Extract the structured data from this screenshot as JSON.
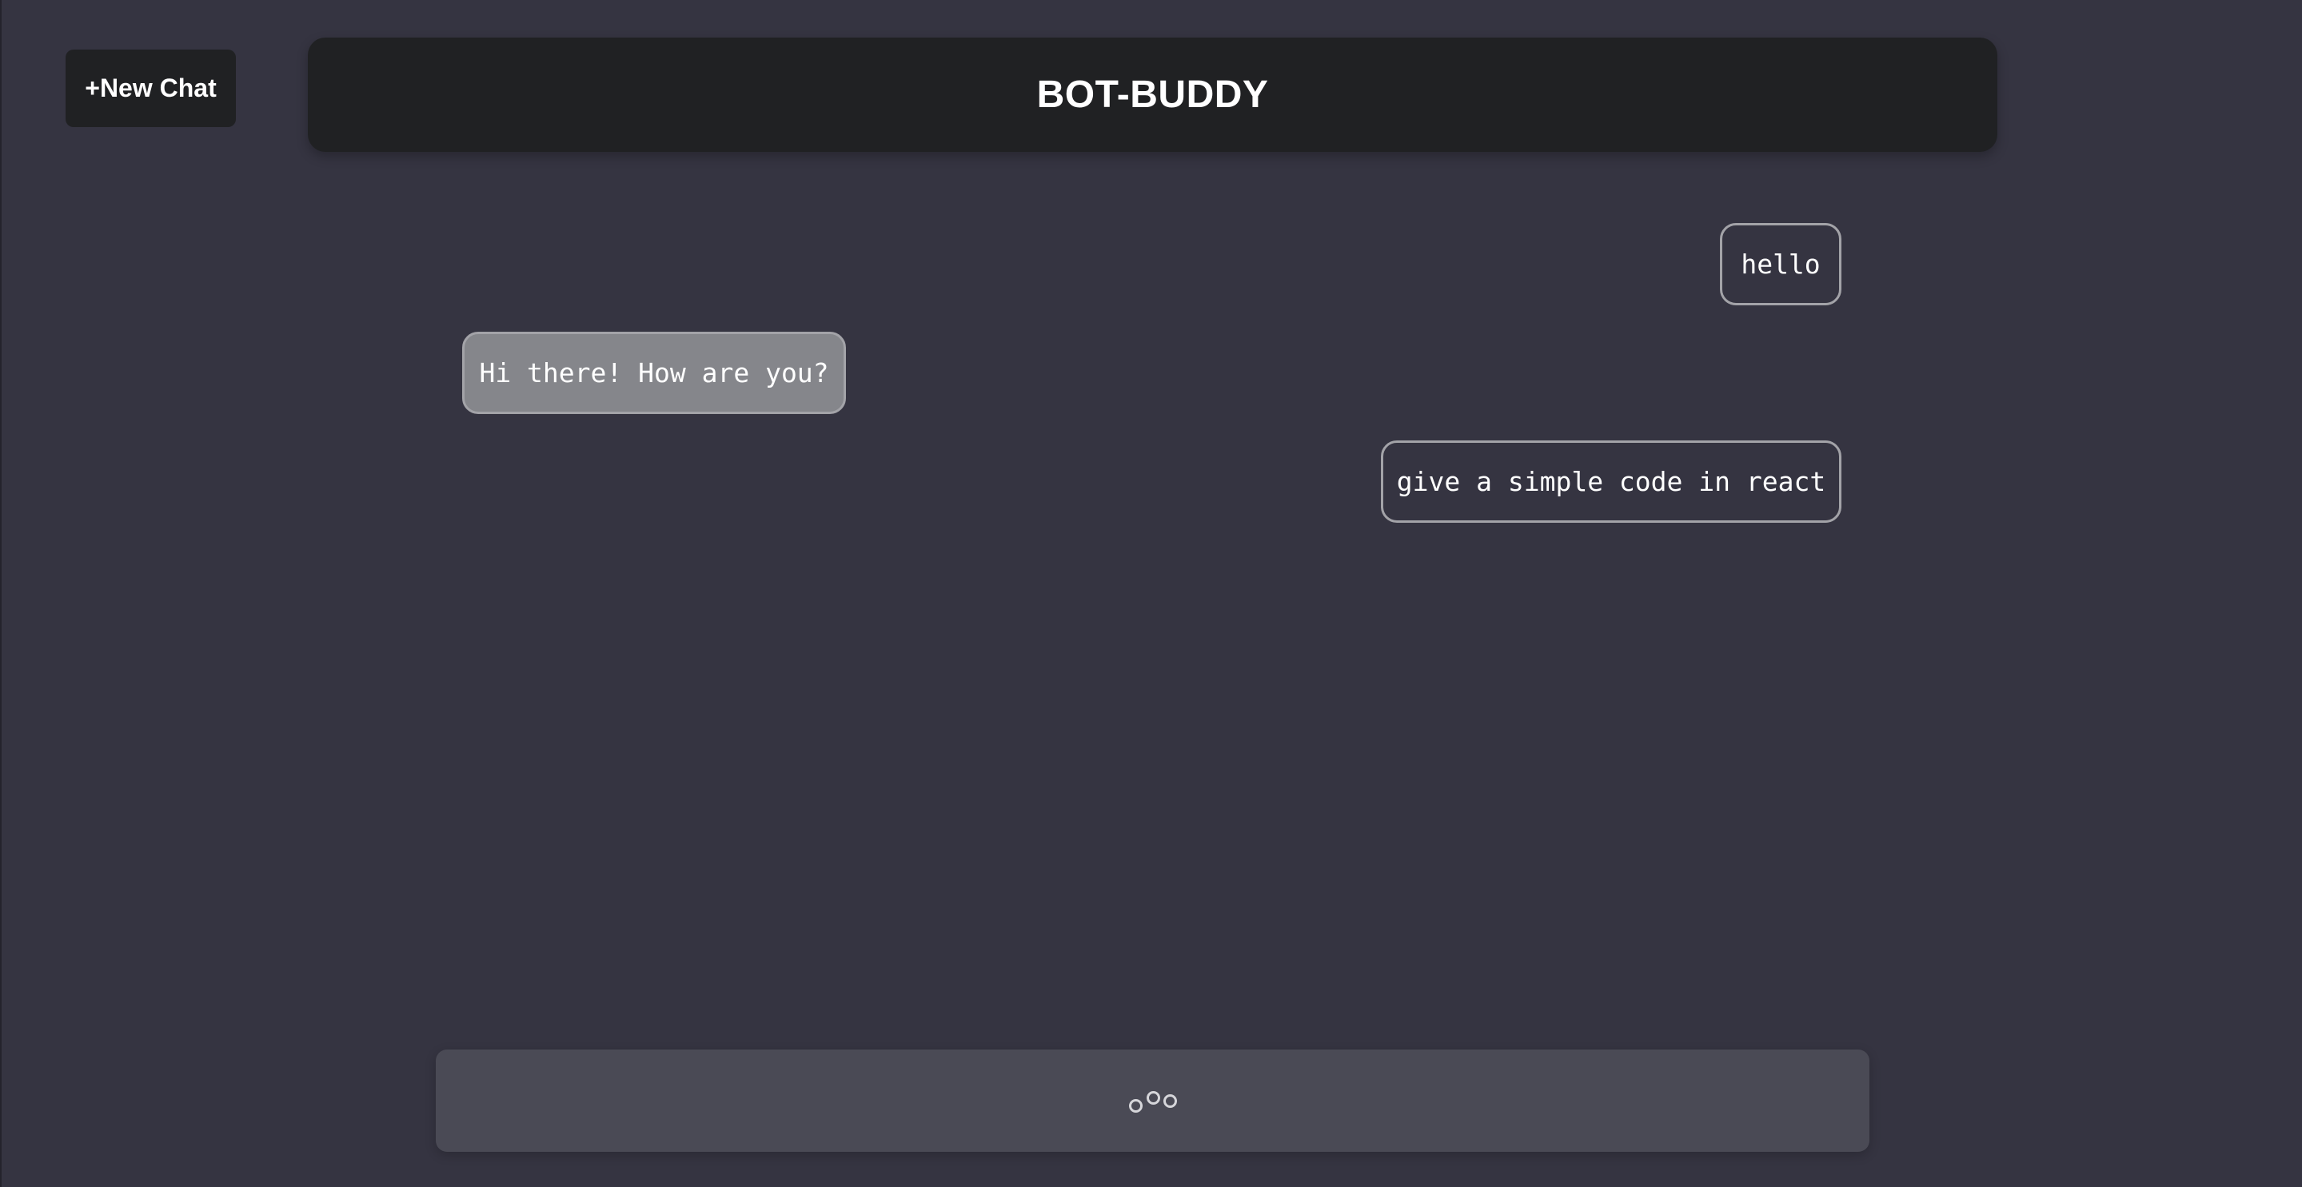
{
  "toolbar": {
    "new_chat_label": "+New Chat"
  },
  "header": {
    "title": "BOT-BUDDY"
  },
  "messages": [
    {
      "role": "user",
      "text": "hello"
    },
    {
      "role": "bot",
      "text": "Hi there! How are you?"
    },
    {
      "role": "user",
      "text": "give a simple code in react"
    }
  ],
  "input": {
    "state": "loading",
    "icon": "loading-dots-icon"
  },
  "colors": {
    "background": "#353441",
    "header_bg": "#202123",
    "bot_bubble_bg": "#85868b",
    "bubble_border": "#a3a3a8",
    "input_bg": "#4a4a55"
  }
}
